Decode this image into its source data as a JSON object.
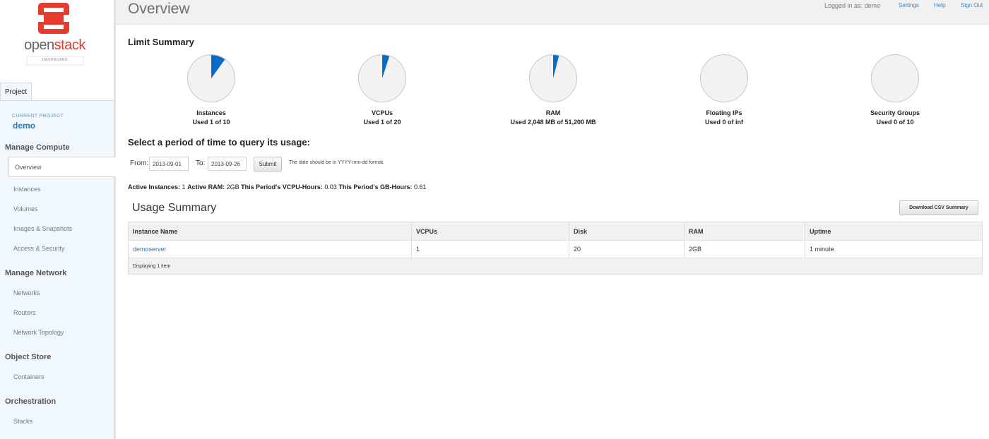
{
  "brand": {
    "name_prefix": "open",
    "name_suffix": "stack",
    "subtitle": "DASHBOARD",
    "logo_color": "#e53c2e"
  },
  "sidebar": {
    "tab_label": "Project",
    "current_project_label": "CURRENT PROJECT",
    "current_project": "demo",
    "sections": [
      {
        "title": "Manage Compute",
        "items": [
          "Overview",
          "Instances",
          "Volumes",
          "Images & Snapshots",
          "Access & Security"
        ]
      },
      {
        "title": "Manage Network",
        "items": [
          "Networks",
          "Routers",
          "Network Topology"
        ]
      },
      {
        "title": "Object Store",
        "items": [
          "Containers"
        ]
      },
      {
        "title": "Orchestration",
        "items": [
          "Stacks"
        ]
      }
    ],
    "active_item": "Overview"
  },
  "header": {
    "title": "Overview",
    "user_label": "Logged in as: demo",
    "links": [
      "Settings",
      "Help",
      "Sign Out"
    ]
  },
  "limit_summary": {
    "title": "Limit Summary",
    "pie_fill_color": "#0a6bc7",
    "pies": [
      {
        "name": "Instances",
        "used_text": "Used 1 of 10",
        "fraction": 0.1
      },
      {
        "name": "VCPUs",
        "used_text": "Used 1 of 20",
        "fraction": 0.05
      },
      {
        "name": "RAM",
        "used_text": "Used 2,048 MB of 51,200 MB",
        "fraction": 0.04
      },
      {
        "name": "Floating IPs",
        "used_text": "Used 0 of inf",
        "fraction": 0
      },
      {
        "name": "Security Groups",
        "used_text": "Used 0 of 10",
        "fraction": 0
      }
    ]
  },
  "query": {
    "title": "Select a period of time to query its usage:",
    "from_label": "From:",
    "from_value": "2013-09-01",
    "to_label": "To:",
    "to_value": "2013-09-26",
    "submit_label": "Submit",
    "hint": "The date should be in YYYY-mm-dd format."
  },
  "stats": {
    "active_instances_label": "Active Instances:",
    "active_instances": "1",
    "active_ram_label": "Active RAM:",
    "active_ram": "2GB",
    "vcpu_hours_label": "This Period's VCPU-Hours:",
    "vcpu_hours": "0.03",
    "gb_hours_label": "This Period's GB-Hours:",
    "gb_hours": "0.61"
  },
  "usage": {
    "title": "Usage Summary",
    "csv_button": "Download CSV Summary",
    "columns": [
      "Instance Name",
      "VCPUs",
      "Disk",
      "RAM",
      "Uptime"
    ],
    "rows": [
      [
        "demoserver",
        "1",
        "20",
        "2GB",
        "1 minute"
      ]
    ],
    "footer": "Displaying 1 item"
  }
}
